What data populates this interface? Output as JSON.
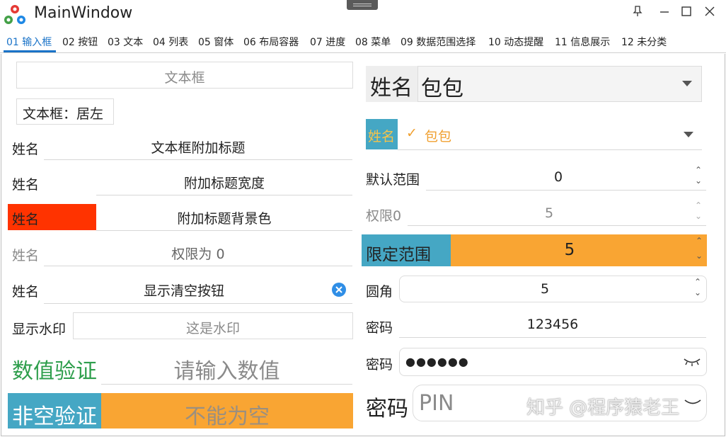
{
  "window": {
    "title": "MainWindow",
    "buttons": {
      "pin": "⊥",
      "minimize": "—",
      "maximize": "☐",
      "close": "✕"
    }
  },
  "tabs": [
    {
      "label": "01 输入框",
      "active": true
    },
    {
      "label": "02 按钮"
    },
    {
      "label": "03 文本"
    },
    {
      "label": "04 列表"
    },
    {
      "label": "05 窗体"
    },
    {
      "label": "06 布局容器"
    },
    {
      "label": "07 进度"
    },
    {
      "label": "08 菜单"
    },
    {
      "label": "09 数据范围选择"
    },
    {
      "label": "10 动态提醒"
    },
    {
      "label": "11 信息展示"
    },
    {
      "label": "12 未分类"
    }
  ],
  "left": {
    "textbox_placeholder": "文本框",
    "left_aligned": "文本框：居左",
    "rows": [
      {
        "label": "姓名",
        "value": "文本框附加标题"
      },
      {
        "label": "姓名",
        "value": "附加标题宽度"
      },
      {
        "label": "姓名",
        "value": "附加标题背景色"
      },
      {
        "label": "姓名",
        "value": "权限为 0"
      },
      {
        "label": "姓名",
        "value": "显示清空按钮"
      }
    ],
    "watermark_label": "显示水印",
    "watermark_placeholder": "这是水印",
    "numeric_label": "数值验证",
    "numeric_placeholder": "请输入数值",
    "required_label": "非空验证",
    "required_placeholder": "不能为空"
  },
  "right": {
    "combo1": {
      "label": "姓名",
      "value": "包包"
    },
    "combo2": {
      "label": "姓名",
      "value": "包包",
      "check": "✓"
    },
    "spin1": {
      "label": "默认范围",
      "value": "0"
    },
    "spin2": {
      "label": "权限0",
      "value": "5"
    },
    "spin3": {
      "label": "限定范围",
      "value": "5"
    },
    "spin4": {
      "label": "圆角",
      "value": "5"
    },
    "password_plain": {
      "label": "密码",
      "value": "123456"
    },
    "password_masked": {
      "label": "密码",
      "value": "●●●●●●"
    },
    "pin": {
      "label": "密码",
      "placeholder": "PIN"
    }
  },
  "overlay_watermark": "知乎 @程序猿老王",
  "colors": {
    "accent": "#1a73c8",
    "red_label": "#ff3300",
    "teal_label": "#45a7c4",
    "orange": "#f9a533",
    "green": "#2e9e4c",
    "clear_button": "#2f8ee6"
  }
}
